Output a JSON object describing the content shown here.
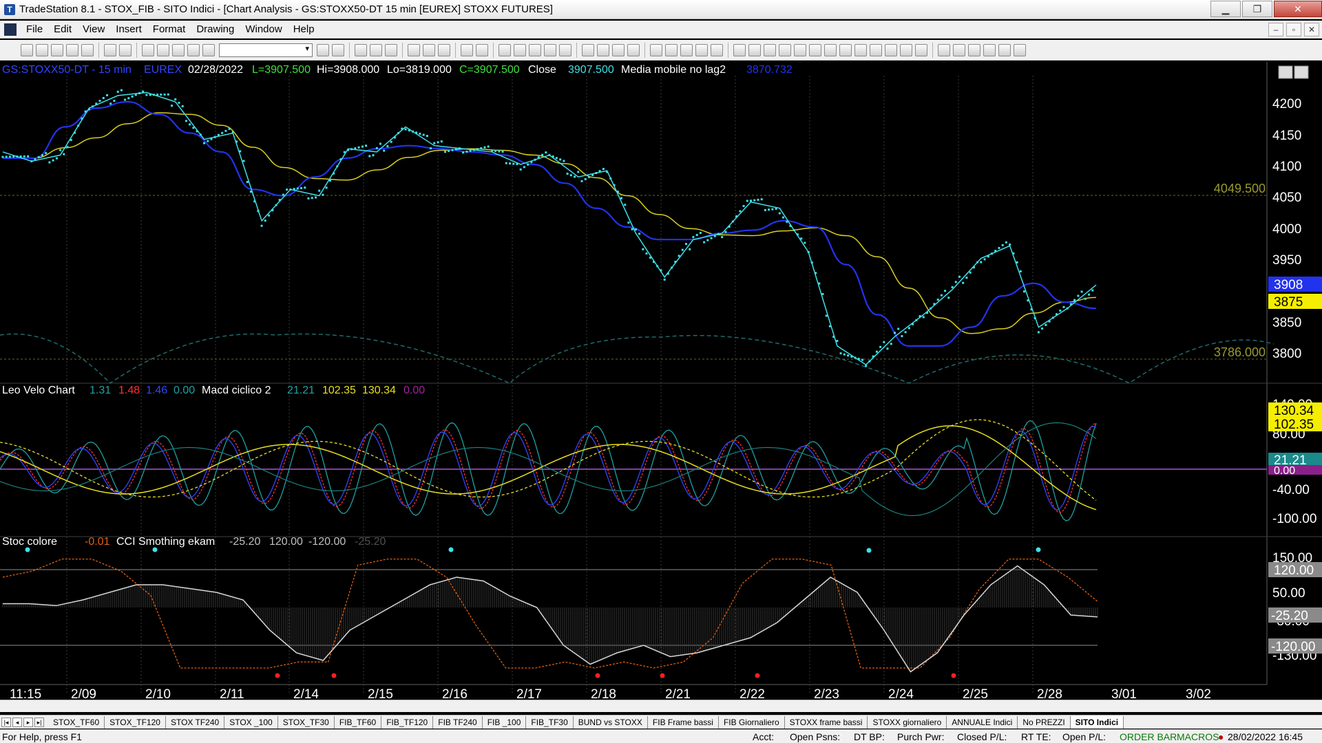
{
  "window": {
    "title": "TradeStation 8.1 - STOX_FIB - SITO Indici - [Chart Analysis - GS:STOXX50-DT  15 min  [EUREX] STOXX FUTURES]",
    "min": "▁",
    "max": "❐",
    "close": "✕"
  },
  "menu": [
    "File",
    "Edit",
    "View",
    "Insert",
    "Format",
    "Drawing",
    "Window",
    "Help"
  ],
  "mdi": [
    "–",
    "▫",
    "✕"
  ],
  "price_pane": {
    "header": {
      "symbol": "GS:STOXX50-DT - 15 min",
      "exchange": "EUREX",
      "date": "02/28/2022",
      "last": "L=3907.500",
      "high": "Hi=3908.000",
      "low": "Lo=3819.000",
      "close_eq": "C=3907.500",
      "close_word": "Close",
      "close_val": "3907.500",
      "ma_name": "Media mobile no lag2",
      "ma_val": "3870.732"
    },
    "ticks": [
      "4200",
      "4150",
      "4100",
      "4050",
      "4000",
      "3950",
      "3850",
      "3800"
    ],
    "level_high": "4049.500",
    "level_low": "3786.000",
    "badge_blue": "3908",
    "badge_yellow": "3875"
  },
  "osc_pane": {
    "header": {
      "name1": "Leo Velo Chart",
      "v1": "1.31",
      "v2": "1.48",
      "v3": "1.46",
      "v4": "0.00",
      "name2": "Macd ciclico 2",
      "v5": "21.21",
      "v6": "102.35",
      "v7": "130.34",
      "v8": "0.00"
    },
    "ticks": [
      "140.00",
      "80.00",
      "-40.00",
      "-100.00"
    ],
    "badge_a": "130.34",
    "badge_b": "102.35",
    "badge_c": "21.21",
    "badge_d": "0.00"
  },
  "stoc_pane": {
    "header": {
      "name1": "Stoc colore",
      "v1": "-0.01",
      "name2": "CCI Smothing ekam",
      "v2": "-25.20",
      "v3": "120.00",
      "v4": "-120.00",
      "v5": "-25.20"
    },
    "ticks": [
      "150.00",
      "50.00",
      "-30.00",
      "-130.00"
    ],
    "badge_120": "120.00",
    "badge_m25": "-25.20",
    "badge_m120": "-120.00"
  },
  "time_axis": [
    "11:15",
    "2/09",
    "2/10",
    "2/11",
    "2/14",
    "2/15",
    "2/16",
    "2/17",
    "2/18",
    "2/21",
    "2/22",
    "2/23",
    "2/24",
    "2/25",
    "2/28",
    "3/01",
    "3/02"
  ],
  "tabs": [
    "STOX_TF60",
    "STOX_TF120",
    "STOX TF240",
    "STOX _100",
    "STOX_TF30",
    "FIB_TF60",
    "FIB_TF120",
    "FIB TF240",
    "FIB _100",
    "FIB_TF30",
    "BUND vs STOXX",
    "FIB Frame bassi",
    "FIB Giornaliero",
    "STOXX frame bassi",
    "STOXX giornaliero",
    "ANNUALE Indici",
    "No PREZZI",
    "SITO Indici"
  ],
  "status": {
    "help": "For Help, press F1",
    "acct": "Acct:",
    "open_psns": "Open Psns:",
    "dt_bp": "DT BP:",
    "purch_pwr": "Purch Pwr:",
    "closed_pl": "Closed P/L:",
    "rt_te": "RT TE:",
    "open_pl": "Open P/L:",
    "order_bar": "ORDER BAR",
    "macros": "MACROS",
    "datetime": "28/02/2022 16:45"
  },
  "colors": {
    "price_dots": "#3fe0e8",
    "ma_blue": "#2233ee",
    "ma_yellow": "#d8d020",
    "grid": "#5a5a30",
    "axis_text": "#ffffff",
    "level_text": "#9a9a30",
    "osc_red": "#ff3030",
    "osc_blue": "#3344ff",
    "osc_teal": "#21a0a0",
    "osc_yellow": "#e8e020",
    "cci_white": "#d8d8d8",
    "cci_cyan": "#40e0e8",
    "cci_orange": "#e06010"
  },
  "chart_data": {
    "type": "line",
    "series": [
      {
        "name": "GS:STOXX50-DT - 15 min",
        "values": [
          4120,
          4105,
          4115,
          4190,
          4210,
          4215,
          4200,
          4140,
          4150,
          4010,
          4060,
          4050,
          4125,
          4120,
          4160,
          4130,
          4125,
          4120,
          4100,
          4115,
          4080,
          4090,
          3990,
          3920,
          3980,
          3990,
          4040,
          4030,
          3960,
          3810,
          3780,
          3825,
          3860,
          3900,
          3950,
          3970,
          3840,
          3870,
          3907.5
        ]
      },
      {
        "name": "Media mobile no lag2",
        "values": [
          4110,
          4110,
          4160,
          4190,
          4200,
          4180,
          4150,
          4120,
          4060,
          4050,
          4080,
          4110,
          4125,
          4130,
          4125,
          4120,
          4115,
          4100,
          4070,
          4030,
          4000,
          3980,
          3980,
          3990,
          3995,
          4010,
          4000,
          3940,
          3860,
          3810,
          3810,
          3840,
          3890,
          3910,
          3880,
          3870
        ]
      }
    ]
  }
}
